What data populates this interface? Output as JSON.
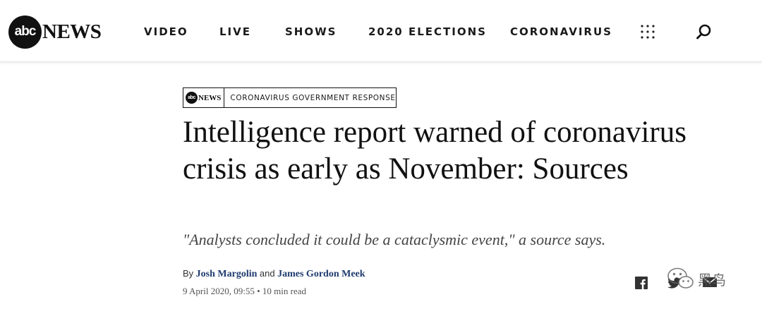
{
  "header": {
    "logo": {
      "abc": "abc",
      "news": "NEWS"
    },
    "nav": [
      "VIDEO",
      "LIVE",
      "SHOWS",
      "2020 ELECTIONS",
      "CORONAVIRUS"
    ],
    "menu_icon": "grid-dots-icon",
    "search_icon": "search-icon"
  },
  "article": {
    "section_logo": {
      "abc": "abc",
      "news": "NEWS"
    },
    "section": "CORONAVIRUS GOVERNMENT RESPONSE",
    "headline": "Intelligence report warned of coronavirus crisis as early as November: Sources",
    "subheadline": "\"Analysts concluded it could be a cataclysmic event,\" a source says.",
    "byline": {
      "by": "By",
      "author1": "Josh Margolin",
      "and": "and",
      "author2": "James Gordon Meek"
    },
    "date": "9 April 2020, 09:55",
    "read_time": "10 min read",
    "meta_separator": "•"
  },
  "share": {
    "icons": [
      "facebook-icon",
      "twitter-icon",
      "email-icon"
    ]
  },
  "watermark": {
    "icon": "wechat-icon",
    "text": "黑鸟"
  },
  "colors": {
    "author_link": "#1f3b6f",
    "nav_text": "#1a1a1a",
    "background": "#ffffff"
  }
}
